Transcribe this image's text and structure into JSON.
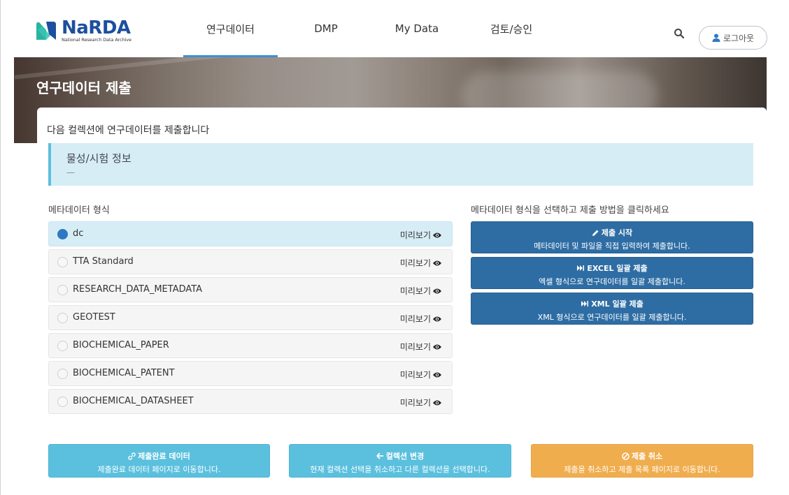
{
  "brand": {
    "title": "NaRDA",
    "subtitle": "National Research Data Archive"
  },
  "nav": [
    {
      "label": "연구데이터",
      "active": true
    },
    {
      "label": "DMP",
      "active": false
    },
    {
      "label": "My Data",
      "active": false
    },
    {
      "label": "검토/승인",
      "active": false
    }
  ],
  "header": {
    "logout_label": "로그아웃"
  },
  "banner": {
    "title": "연구데이터 제출"
  },
  "page": {
    "subtitle": "다음 컬렉션에 연구데이터를 제출합니다",
    "collection": {
      "title": "물성/시험 정보",
      "value": "—"
    }
  },
  "metadata": {
    "label": "메타데이터 형식",
    "preview_label": "미리보기",
    "selected": "dc",
    "items": [
      {
        "name": "dc"
      },
      {
        "name": "TTA Standard"
      },
      {
        "name": "RESEARCH_DATA_METADATA"
      },
      {
        "name": "GEOTEST"
      },
      {
        "name": "BIOCHEMICAL_PAPER"
      },
      {
        "name": "BIOCHEMICAL_PATENT"
      },
      {
        "name": "BIOCHEMICAL_DATASHEET"
      }
    ]
  },
  "actions": {
    "label": "메타데이터 형식을 선택하고 제출 방법을 클릭하세요",
    "buttons": [
      {
        "title": "제출 시작",
        "desc": "메타데이터 및 파일을 직접 입력하여 제출합니다.",
        "icon": "pencil-icon"
      },
      {
        "title": "EXCEL 일괄 제출",
        "desc": "엑셀 형식으로 연구데이터를 일괄 제출합니다.",
        "icon": "fast-forward-icon"
      },
      {
        "title": "XML 일괄 제출",
        "desc": "XML 형식으로 연구데이터를 일괄 제출합니다.",
        "icon": "fast-forward-icon"
      }
    ]
  },
  "bottom": {
    "completed": {
      "title": "제출완료 데이터",
      "desc": "제출완료 데이터 페이지로 이동합니다.",
      "icon": "link-icon"
    },
    "change": {
      "title": "컬렉션 변경",
      "desc": "현재 컬렉션 선택을 취소하고 다른 컬렉션을 선택합니다.",
      "icon": "arrow-left-icon"
    },
    "cancel": {
      "title": "제출 취소",
      "desc": "제출을 취소하고 제출 목록 페이지로 이동합니다.",
      "icon": "ban-icon"
    }
  },
  "colors": {
    "primary": "#2e6da4",
    "info": "#5bc0de",
    "warning": "#f0ad4e",
    "brand": "#1d4f9e",
    "nav_active": "#3f8fd4"
  }
}
